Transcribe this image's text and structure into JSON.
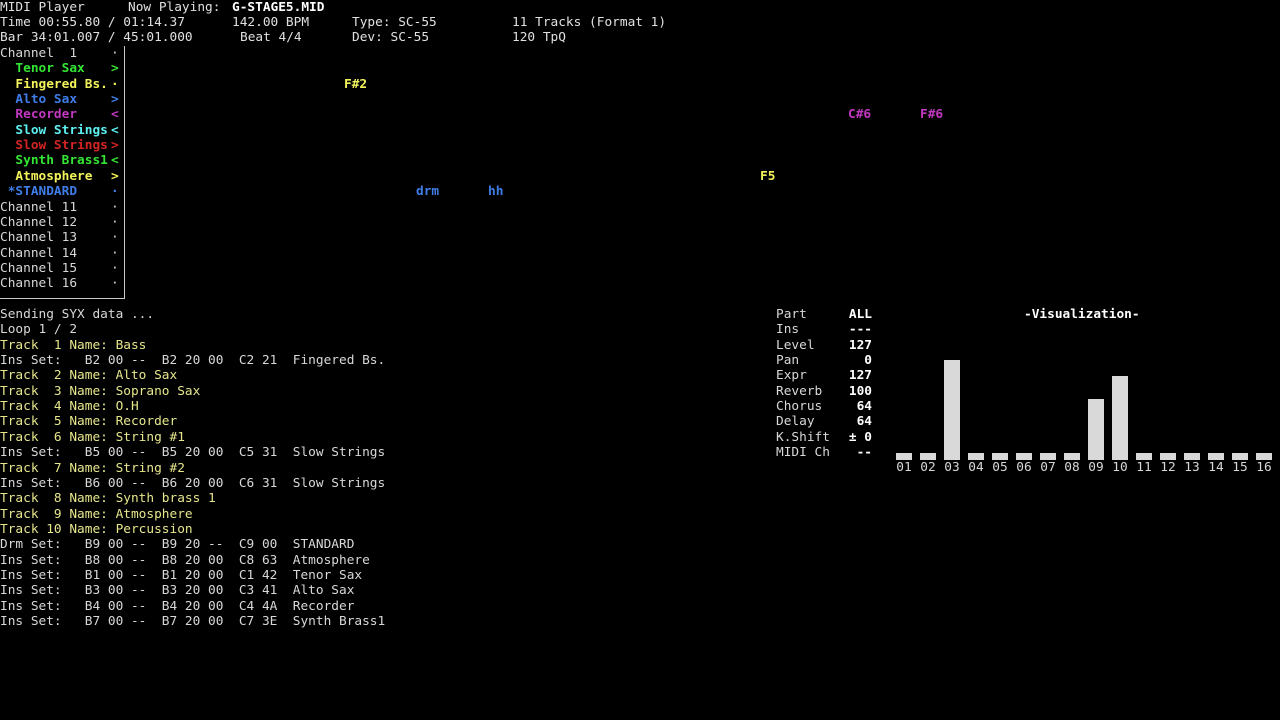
{
  "header": {
    "app_title": "MIDI Player",
    "now_playing_label": "Now Playing:",
    "file_name": "G-STAGE5.MID",
    "time": "Time 00:55.80 / 01:14.37",
    "bpm": "142.00 BPM",
    "type": "Type: SC-55",
    "tracks": "11 Tracks (Format 1)",
    "bar": "Bar 34:01.007 / 45:01.000",
    "beat": "Beat 4/4",
    "dev": "Dev: SC-55",
    "tpq": "120 TpQ"
  },
  "channels": [
    {
      "name": "Channel  1",
      "marker": "·",
      "color": "#d8d8d8",
      "bold": false
    },
    {
      "name": "  Tenor Sax",
      "marker": ">",
      "color": "#34e634",
      "bold": true
    },
    {
      "name": "  Fingered Bs.",
      "marker": "·",
      "color": "#f2f25a",
      "bold": true
    },
    {
      "name": "  Alto Sax",
      "marker": ">",
      "color": "#3f7de8",
      "bold": true
    },
    {
      "name": "  Recorder",
      "marker": "<",
      "color": "#c238c2",
      "bold": true
    },
    {
      "name": "  Slow Strings",
      "marker": "<",
      "color": "#5ef0f0",
      "bold": true
    },
    {
      "name": "  Slow Strings",
      "marker": ">",
      "color": "#d42424",
      "bold": true
    },
    {
      "name": "  Synth Brass1",
      "marker": "<",
      "color": "#34e634",
      "bold": true
    },
    {
      "name": "  Atmosphere",
      "marker": ">",
      "color": "#f2f25a",
      "bold": true
    },
    {
      "name": " *STANDARD",
      "marker": "·",
      "color": "#3f7de8",
      "bold": true
    },
    {
      "name": "Channel 11",
      "marker": "·",
      "color": "#d8d8d8",
      "bold": false
    },
    {
      "name": "Channel 12",
      "marker": "·",
      "color": "#d8d8d8",
      "bold": false
    },
    {
      "name": "Channel 13",
      "marker": "·",
      "color": "#d8d8d8",
      "bold": false
    },
    {
      "name": "Channel 14",
      "marker": "·",
      "color": "#d8d8d8",
      "bold": false
    },
    {
      "name": "Channel 15",
      "marker": "·",
      "color": "#d8d8d8",
      "bold": false
    },
    {
      "name": "Channel 16",
      "marker": "·",
      "color": "#d8d8d8",
      "bold": false
    }
  ],
  "notes": [
    {
      "text": "F#2",
      "color": "#f2f25a"
    },
    {
      "text": "C#6",
      "color": "#c238c2"
    },
    {
      "text": "F#6",
      "color": "#c238c2"
    },
    {
      "text": "F5",
      "color": "#f2f25a"
    },
    {
      "text": "drm",
      "color": "#3f7de8"
    },
    {
      "text": "hh",
      "color": "#3f7de8"
    }
  ],
  "log": [
    {
      "text": "Sending SYX data ...",
      "kind": "ins"
    },
    {
      "text": "Loop 1 / 2",
      "kind": "ins"
    },
    {
      "text": "Track  1 Name: Bass",
      "kind": "trk"
    },
    {
      "text": "Ins Set:   B2 00 --  B2 20 00  C2 21  Fingered Bs.",
      "kind": "ins"
    },
    {
      "text": "Track  2 Name: Alto Sax",
      "kind": "trk"
    },
    {
      "text": "Track  3 Name: Soprano Sax",
      "kind": "trk"
    },
    {
      "text": "Track  4 Name: O.H",
      "kind": "trk"
    },
    {
      "text": "Track  5 Name: Recorder",
      "kind": "trk"
    },
    {
      "text": "Track  6 Name: String #1",
      "kind": "trk"
    },
    {
      "text": "Ins Set:   B5 00 --  B5 20 00  C5 31  Slow Strings",
      "kind": "ins"
    },
    {
      "text": "Track  7 Name: String #2",
      "kind": "trk"
    },
    {
      "text": "Ins Set:   B6 00 --  B6 20 00  C6 31  Slow Strings",
      "kind": "ins"
    },
    {
      "text": "Track  8 Name: Synth brass 1",
      "kind": "trk"
    },
    {
      "text": "Track  9 Name: Atmosphere",
      "kind": "trk"
    },
    {
      "text": "Track 10 Name: Percussion",
      "kind": "trk"
    },
    {
      "text": "Drm Set:   B9 00 --  B9 20 --  C9 00  STANDARD",
      "kind": "ins"
    },
    {
      "text": "Ins Set:   B8 00 --  B8 20 00  C8 63  Atmosphere",
      "kind": "ins"
    },
    {
      "text": "Ins Set:   B1 00 --  B1 20 00  C1 42  Tenor Sax",
      "kind": "ins"
    },
    {
      "text": "Ins Set:   B3 00 --  B3 20 00  C3 41  Alto Sax",
      "kind": "ins"
    },
    {
      "text": "Ins Set:   B4 00 --  B4 20 00  C4 4A  Recorder",
      "kind": "ins"
    },
    {
      "text": "Ins Set:   B7 00 --  B7 20 00  C7 3E  Synth Brass1",
      "kind": "ins"
    }
  ],
  "part_params": [
    {
      "label": "Part",
      "value": "ALL"
    },
    {
      "label": "Ins",
      "value": "---"
    },
    {
      "label": "Level",
      "value": "127"
    },
    {
      "label": "Pan",
      "value": "0"
    },
    {
      "label": "Expr",
      "value": "127"
    },
    {
      "label": "Reverb",
      "value": "100"
    },
    {
      "label": "Chorus",
      "value": "64"
    },
    {
      "label": "Delay",
      "value": "64"
    },
    {
      "label": "K.Shift",
      "value": "± 0"
    },
    {
      "label": "MIDI Ch",
      "value": "--"
    }
  ],
  "visualization": {
    "title": "-Visualization-",
    "channels": [
      "01",
      "02",
      "03",
      "04",
      "05",
      "06",
      "07",
      "08",
      "09",
      "10",
      "11",
      "12",
      "13",
      "14",
      "15",
      "16"
    ],
    "levels": [
      0.07,
      0.07,
      1.0,
      0.07,
      0.07,
      0.07,
      0.07,
      0.07,
      0.61,
      0.84,
      0.07,
      0.07,
      0.07,
      0.07,
      0.07,
      0.07
    ],
    "bar_color": "#d9d9d9"
  }
}
